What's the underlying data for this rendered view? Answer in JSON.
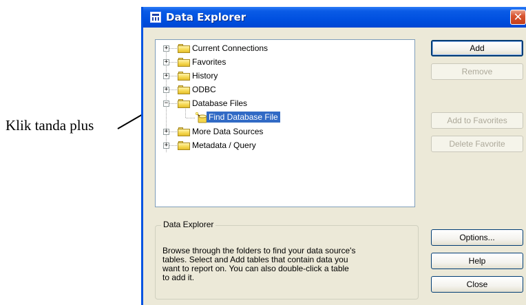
{
  "annotation": {
    "text": "Klik tanda plus"
  },
  "window": {
    "title": "Data Explorer",
    "close_glyph": "✕"
  },
  "tree": {
    "items": [
      {
        "label": "Current Connections",
        "expander": "+",
        "icon": "folder-icon"
      },
      {
        "label": "Favorites",
        "expander": "+",
        "icon": "folder-icon"
      },
      {
        "label": "History",
        "expander": "+",
        "icon": "folder-icon"
      },
      {
        "label": "ODBC",
        "expander": "+",
        "icon": "folder-icon"
      },
      {
        "label": "Database Files",
        "expander": "−",
        "icon": "folder-icon",
        "children": [
          {
            "label": "Find Database File",
            "icon": "find-wizard-icon",
            "selected": true
          }
        ]
      },
      {
        "label": "More Data Sources",
        "expander": "+",
        "icon": "folder-icon"
      },
      {
        "label": "Metadata / Query",
        "expander": "+",
        "icon": "folder-icon"
      }
    ]
  },
  "buttons": {
    "add": "Add",
    "remove": "Remove",
    "add_to_favorites": "Add to Favorites",
    "delete_favorite": "Delete Favorite",
    "options": "Options...",
    "help": "Help",
    "close": "Close"
  },
  "info": {
    "legend": "Data Explorer",
    "line1": "Browse through the folders to find your data source's",
    "line2": "tables.  Select and Add tables that contain data you",
    "line3": "want to report on.  You can also double-click a table",
    "line4": "to add it."
  },
  "colors": {
    "title_bar": "#0a5be6",
    "selection": "#316ac5",
    "dialog_face": "#ece9d8"
  }
}
